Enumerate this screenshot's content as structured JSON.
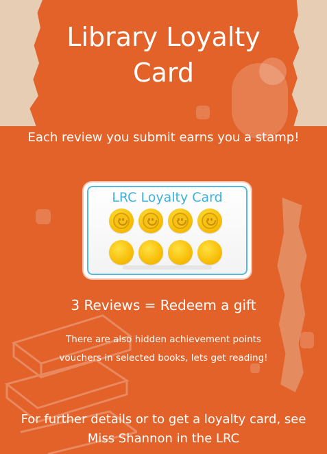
{
  "poster": {
    "title": "Library Loyalty Card",
    "tagline": "Each review you submit earns you a stamp!",
    "card": {
      "title": "LRC Loyalty Card",
      "stamps_total": 8,
      "stamps_filled": 4,
      "stamp_icon": "smiley-stamp-icon",
      "empty_icon": "empty-stamp-icon"
    },
    "redeem_text": "3 Reviews = Redeem a gift",
    "hidden_note": "There are also hidden achievement points vouchers in selected books, lets get reading!",
    "details_text": "For further details or to get a loyalty card, see Miss Shannon in the LRC",
    "colors": {
      "background": "#e2622a",
      "card_accent": "#3bb0dd",
      "stamp": "#f6b800"
    }
  }
}
